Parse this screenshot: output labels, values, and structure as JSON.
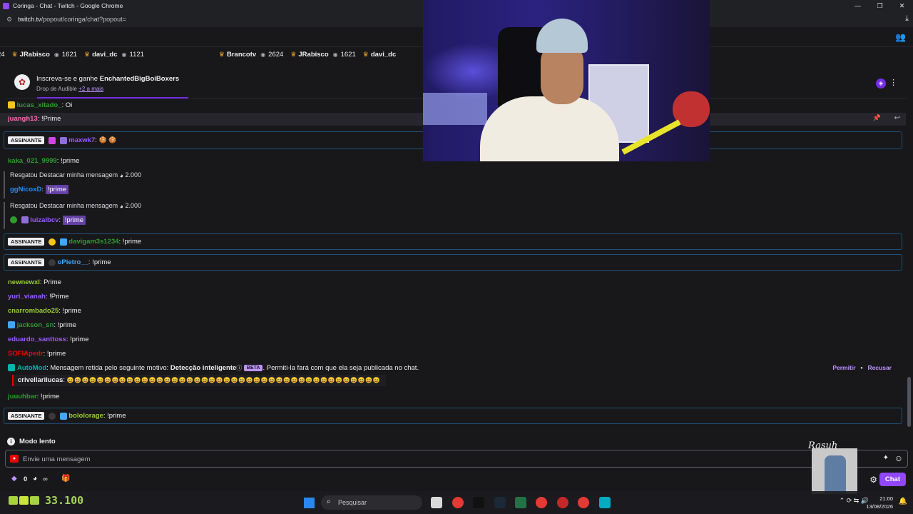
{
  "browser": {
    "window_title": "Coringa - Chat - Twitch - Google Chrome",
    "url_host": "twitch.tv",
    "url_path": "/popout/coringa/chat?popout=",
    "controls": [
      "—",
      "❐",
      "✕"
    ]
  },
  "ticker": [
    {
      "name": "",
      "count": "24",
      "partial": true
    },
    {
      "name": "JRabisco",
      "count": "1621"
    },
    {
      "name": "davi_dc",
      "count": "1121"
    },
    {
      "name": "Brancotv",
      "count": "2624"
    },
    {
      "name": "JRabisco",
      "count": "1621"
    },
    {
      "name": "davi_dc",
      "count": ""
    }
  ],
  "drop": {
    "prefix": "Inscreva-se e ganhe ",
    "reward": "EnchantedBigBoiBoxers",
    "source": "Drop de Audible",
    "more": "+2 a mais"
  },
  "sub_badge": "ASSINANTE",
  "chat": {
    "partial": {
      "user": "lucas_xitado_",
      "msg": ": Oi"
    },
    "juangh": {
      "user": "juangh13",
      "msg": ": !Prime"
    },
    "maxwk": {
      "user": "maxwk7",
      "msg": ":"
    },
    "kaka": {
      "user": "kaka_021_9999",
      "msg": ": !prime"
    },
    "redeem1": {
      "text": "Resgatou Destacar minha mensagem",
      "cost": "2.000",
      "user": "ggNicoxD",
      "msg": "!prime"
    },
    "redeem2": {
      "text": "Resgatou Destacar minha mensagem",
      "cost": "2.000",
      "user": "luizalbcv",
      "msg": "!prime"
    },
    "davigam": {
      "user": "davigam3s1234",
      "msg": ": !prime"
    },
    "opietro": {
      "user": "oPietro__",
      "msg": ": !prime"
    },
    "newnew": {
      "user": "newnewxl",
      "msg": ": Prime"
    },
    "yuri": {
      "user": "yuri_vianah",
      "msg": ": !Prime"
    },
    "cnar": {
      "user": "cnarrombado25",
      "msg": ": !prime"
    },
    "jackson": {
      "user": "jackson_sn",
      "msg": ": !prime"
    },
    "eduardo": {
      "user": "eduardo_santtoss",
      "msg": ": !prime"
    },
    "sofia": {
      "user": "SOFIApedr",
      "msg": ": !prime"
    },
    "juuu": {
      "user": "juuuhbar",
      "msg": ": !prime"
    },
    "bolo": {
      "user": "bololorage",
      "msg": ": !prime"
    }
  },
  "automod": {
    "name": "AutoMod",
    "text": ": Mensagem retida pelo seguinte motivo: ",
    "reason": "Detecção inteligente",
    "beta": "BETA",
    "tail": ". Permiti-la fará com que ela seja publicada no chat.",
    "allow": "Permitir",
    "deny": "Recusar",
    "held_user": "crivellarilucas",
    "held_msg": "😄😄😄😄😄😄😄😄😄😄😄😄😄😄😄😄😄😄😄😄😄😄😄😄😄😄😄😄😄😄😄😄😄😄😄😄😄😄😄😄😄😄"
  },
  "composer": {
    "slow_mode": "Modo lento",
    "placeholder": "Envie uma mensagem",
    "bits_count": "0",
    "points": "∞",
    "chat_button": "Chat"
  },
  "overlay": {
    "cam_label": "Rasuh",
    "counter": "33.100"
  },
  "taskbar": {
    "search_placeholder": "Pesquisar",
    "time": "21:00",
    "date": "13/08/2026"
  },
  "colors": {
    "twitch_purple": "#9146ff",
    "sub_border": "#1f4f73",
    "highlight": "#6441a5"
  }
}
